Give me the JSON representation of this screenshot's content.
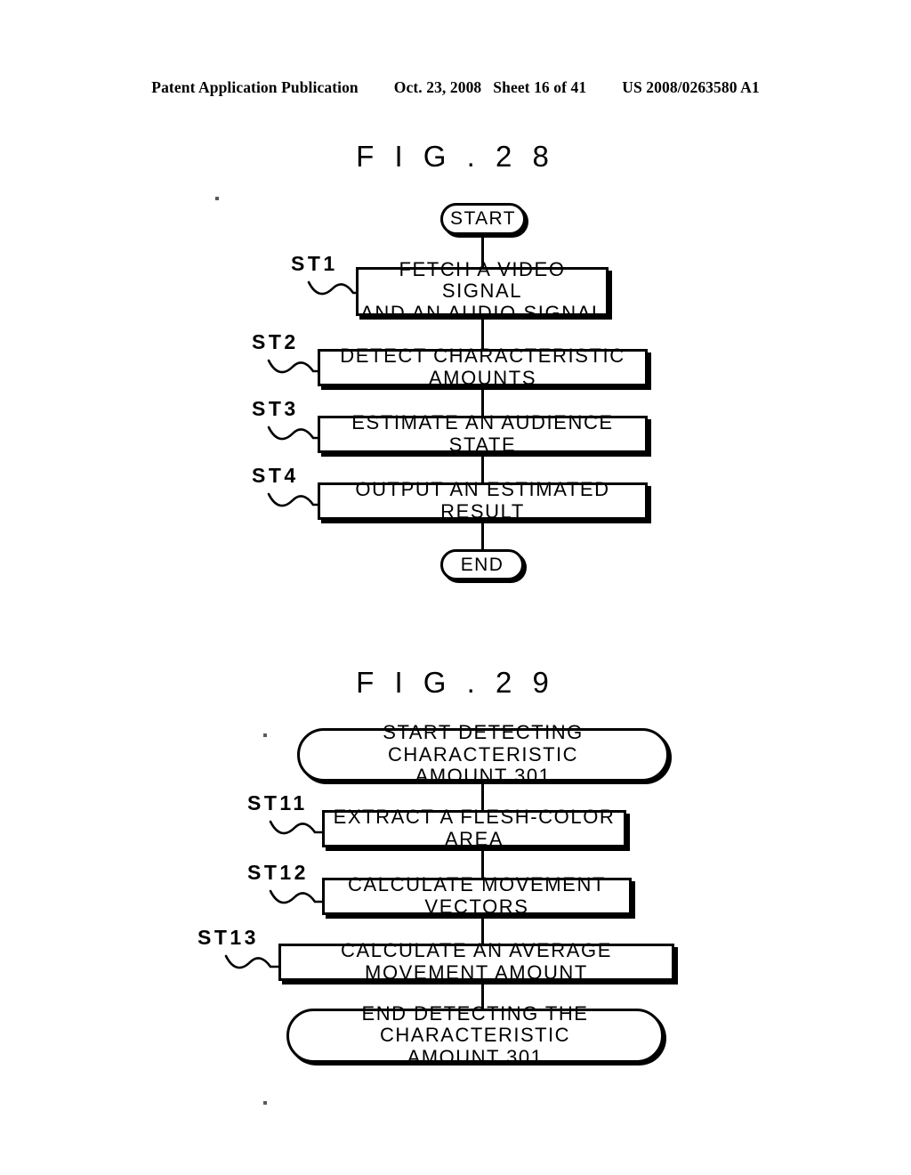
{
  "header": {
    "publication": "Patent Application Publication",
    "date": "Oct. 23, 2008",
    "sheet": "Sheet 16 of 41",
    "docnum": "US 2008/0263580 A1"
  },
  "figures": [
    {
      "title": "F I G .  2 8",
      "start_label": "START",
      "end_label": "END",
      "steps": [
        {
          "ref": "ST1",
          "text": "FETCH A VIDEO SIGNAL\nAND AN AUDIO SIGNAL"
        },
        {
          "ref": "ST2",
          "text": "DETECT CHARACTERISTIC AMOUNTS"
        },
        {
          "ref": "ST3",
          "text": "ESTIMATE AN AUDIENCE STATE"
        },
        {
          "ref": "ST4",
          "text": "OUTPUT AN ESTIMATED RESULT"
        }
      ]
    },
    {
      "title": "F I G .  2 9",
      "start_label": "START DETECTING CHARACTERISTIC\nAMOUNT 301",
      "end_label": "END DETECTING THE CHARACTERISTIC\nAMOUNT 301",
      "steps": [
        {
          "ref": "ST11",
          "text": "EXTRACT A FLESH-COLOR AREA"
        },
        {
          "ref": "ST12",
          "text": "CALCULATE MOVEMENT VECTORS"
        },
        {
          "ref": "ST13",
          "text": "CALCULATE AN AVERAGE MOVEMENT AMOUNT"
        }
      ]
    }
  ],
  "colors": {
    "ink": "#000000",
    "paper": "#ffffff"
  }
}
